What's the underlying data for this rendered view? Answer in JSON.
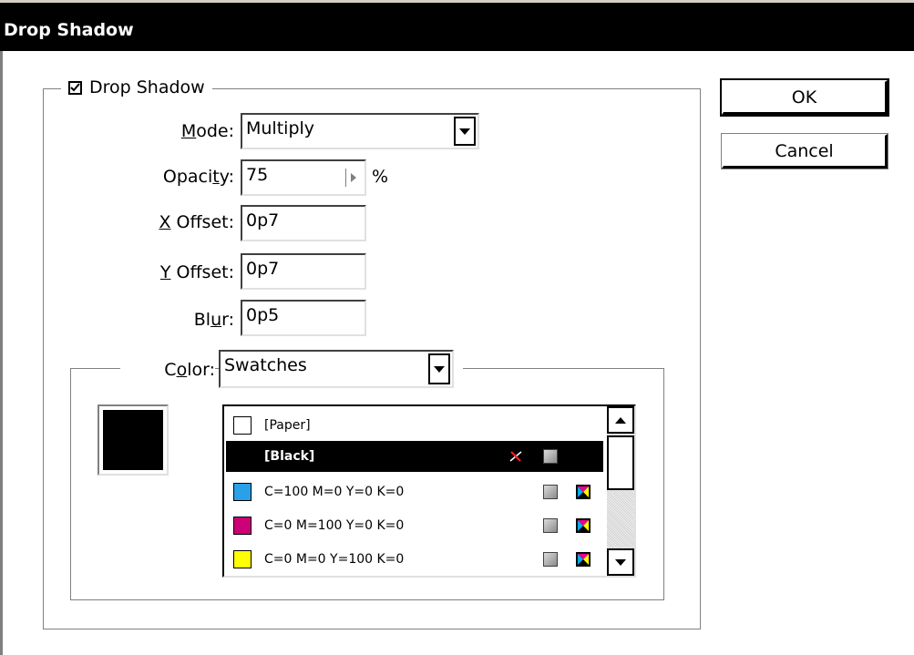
{
  "window": {
    "title": "Drop Shadow"
  },
  "drop_shadow": {
    "checkbox_label": "Drop Shadow",
    "checked": true,
    "mode": {
      "label_pre": "",
      "label_u": "M",
      "label_post": "ode:",
      "value": "Multiply"
    },
    "opacity": {
      "label_pre": "Opaci",
      "label_u": "t",
      "label_post": "y:",
      "value": "75",
      "unit": "%"
    },
    "x_offset": {
      "label_pre": "",
      "label_u": "X",
      "label_post": " Offset:",
      "value": "0p7"
    },
    "y_offset": {
      "label_pre": "",
      "label_u": "Y",
      "label_post": " Offset:",
      "value": "0p7"
    },
    "blur": {
      "label_pre": "Bl",
      "label_u": "u",
      "label_post": "r:",
      "value": "0p5"
    }
  },
  "color": {
    "label_pre": "C",
    "label_u": "o",
    "label_post": "lor:",
    "source": "Swatches",
    "preview_color": "#000000",
    "swatches": [
      {
        "name": "[Paper]",
        "color": "#ffffff",
        "selected": false,
        "icons": []
      },
      {
        "name": "[Black]",
        "color": "#000000",
        "selected": true,
        "icons": [
          "no-edit-icon",
          "process-icon"
        ]
      },
      {
        "name": "C=100 M=0 Y=0 K=0",
        "color": "#2aa0e8",
        "selected": false,
        "icons": [
          "process-icon",
          "cmyk-icon"
        ]
      },
      {
        "name": "C=0 M=100 Y=0 K=0",
        "color": "#cc0077",
        "selected": false,
        "icons": [
          "process-icon",
          "cmyk-icon"
        ]
      },
      {
        "name": "C=0 M=0 Y=100 K=0",
        "color": "#ffff00",
        "selected": false,
        "icons": [
          "process-icon",
          "cmyk-icon"
        ]
      }
    ]
  },
  "buttons": {
    "ok": "OK",
    "cancel": "Cancel"
  }
}
